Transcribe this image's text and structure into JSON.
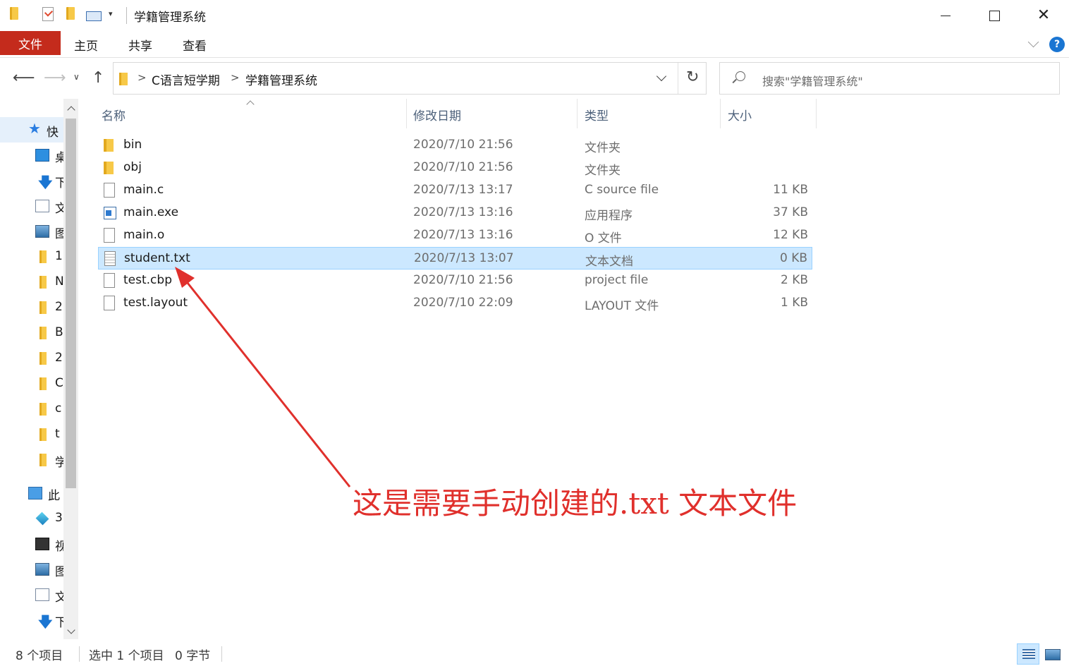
{
  "window": {
    "title": "学籍管理系统"
  },
  "ribbon": {
    "file_tab": "文件",
    "tabs": [
      "主页",
      "共享",
      "查看"
    ],
    "help": "?"
  },
  "address": {
    "crumbs": [
      "C语言短学期",
      "学籍管理系统"
    ],
    "separator": ">"
  },
  "search": {
    "placeholder": "搜索\"学籍管理系统\""
  },
  "nav_pane": {
    "quick_access_label": "快",
    "items": [
      {
        "label": "桌",
        "icon": "desktop-icon"
      },
      {
        "label": "下",
        "icon": "download-icon"
      },
      {
        "label": "文",
        "icon": "document-icon"
      },
      {
        "label": "图",
        "icon": "picture-icon"
      },
      {
        "label": "1",
        "icon": "folder-icon"
      },
      {
        "label": "N",
        "icon": "folder-icon"
      },
      {
        "label": "2",
        "icon": "folder-icon"
      },
      {
        "label": "B",
        "icon": "folder-icon"
      },
      {
        "label": "2",
        "icon": "folder-icon"
      },
      {
        "label": "C",
        "icon": "folder-icon"
      },
      {
        "label": "c",
        "icon": "folder-icon"
      },
      {
        "label": "t",
        "icon": "folder-icon"
      },
      {
        "label": "学",
        "icon": "folder-icon"
      }
    ],
    "this_pc_label": "此",
    "pc_items": [
      {
        "label": "3",
        "icon": "3d-objects-icon"
      },
      {
        "label": "视",
        "icon": "video-icon"
      },
      {
        "label": "图",
        "icon": "picture-icon"
      },
      {
        "label": "文",
        "icon": "document-icon"
      },
      {
        "label": "下",
        "icon": "download-icon"
      }
    ]
  },
  "columns": {
    "name": "名称",
    "date": "修改日期",
    "type": "类型",
    "size": "大小"
  },
  "files": [
    {
      "name": "bin",
      "date": "2020/7/10 21:56",
      "type": "文件夹",
      "size": "",
      "icon": "folder-icon",
      "selected": false
    },
    {
      "name": "obj",
      "date": "2020/7/10 21:56",
      "type": "文件夹",
      "size": "",
      "icon": "folder-icon",
      "selected": false
    },
    {
      "name": "main.c",
      "date": "2020/7/13 13:17",
      "type": "C source file",
      "size": "11 KB",
      "icon": "file-icon",
      "selected": false
    },
    {
      "name": "main.exe",
      "date": "2020/7/13 13:16",
      "type": "应用程序",
      "size": "37 KB",
      "icon": "exe-icon",
      "selected": false
    },
    {
      "name": "main.o",
      "date": "2020/7/13 13:16",
      "type": "O 文件",
      "size": "12 KB",
      "icon": "file-icon",
      "selected": false
    },
    {
      "name": "student.txt",
      "date": "2020/7/13 13:07",
      "type": "文本文档",
      "size": "0 KB",
      "icon": "txt-icon",
      "selected": true
    },
    {
      "name": "test.cbp",
      "date": "2020/7/10 21:56",
      "type": "project file",
      "size": "2 KB",
      "icon": "file-icon",
      "selected": false
    },
    {
      "name": "test.layout",
      "date": "2020/7/10 22:09",
      "type": "LAYOUT 文件",
      "size": "1 KB",
      "icon": "file-icon",
      "selected": false
    }
  ],
  "annotation": {
    "text": "这是需要手动创建的.txt 文本文件",
    "color": "#e0302c"
  },
  "status": {
    "count": "8 个项目",
    "selection": "选中 1 个项目",
    "bytes": "0 字节"
  },
  "colors": {
    "file_tab": "#c42b1c",
    "selection": "#cce8ff",
    "accent": "#1a75d2"
  }
}
